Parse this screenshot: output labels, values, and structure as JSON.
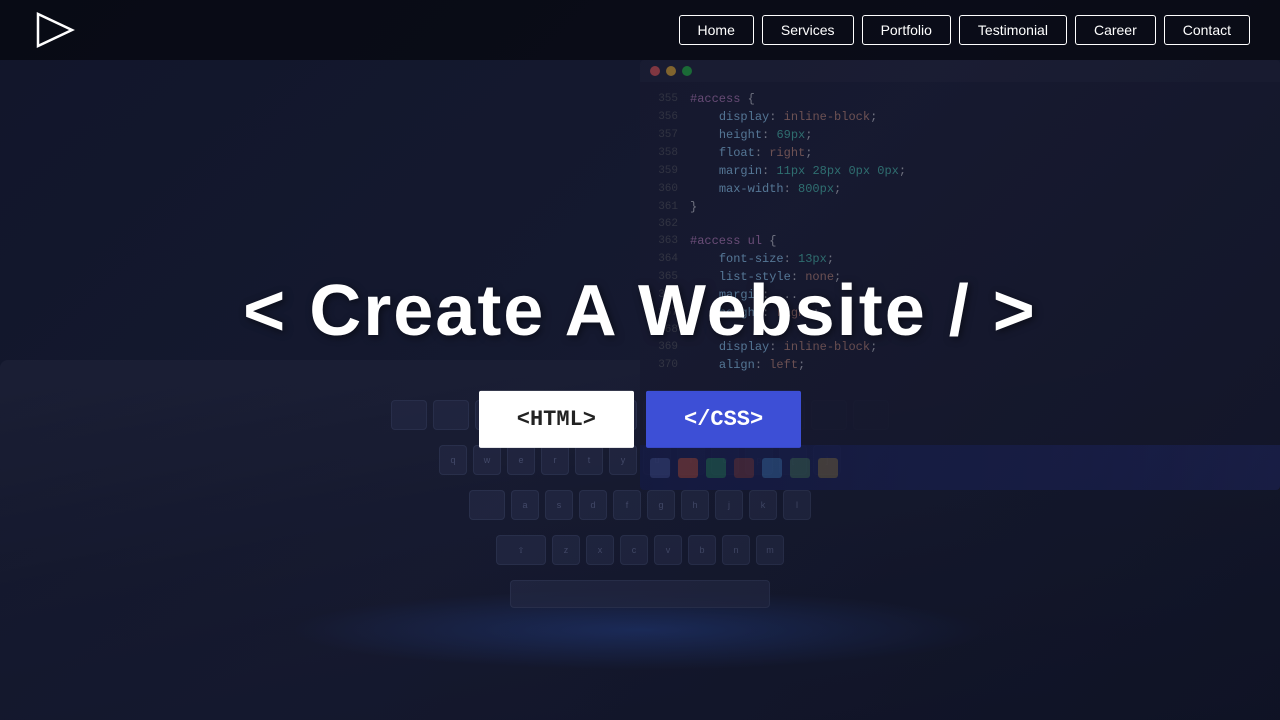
{
  "nav": {
    "links": [
      {
        "label": "Home",
        "id": "home"
      },
      {
        "label": "Services",
        "id": "services"
      },
      {
        "label": "Portfolio",
        "id": "portfolio"
      },
      {
        "label": "Testimonial",
        "id": "testimonial"
      },
      {
        "label": "Career",
        "id": "career"
      },
      {
        "label": "Contact",
        "id": "contact"
      }
    ]
  },
  "hero": {
    "title": "< Create A Website / >",
    "btn_html": "<HTML>",
    "btn_css": "</CSS>"
  },
  "code": {
    "lines": [
      {
        "num": "355",
        "content": "#access {"
      },
      {
        "num": "356",
        "content": "    display: inline-block;"
      },
      {
        "num": "357",
        "content": "    height: 69px;"
      },
      {
        "num": "358",
        "content": "    float: right;"
      },
      {
        "num": "359",
        "content": "    margin: 11px 28px 0px 0px;"
      },
      {
        "num": "360",
        "content": "    max-width: 800px;"
      },
      {
        "num": "361",
        "content": "}"
      },
      {
        "num": "362",
        "content": ""
      },
      {
        "num": "363",
        "content": "#access ul {"
      },
      {
        "num": "364",
        "content": "    font-size: 13px;"
      },
      {
        "num": "365",
        "content": "    list-style: none;"
      },
      {
        "num": "366",
        "content": "    margin: ..."
      },
      {
        "num": "367",
        "content": "    height: right;"
      },
      {
        "num": "368",
        "content": ""
      },
      {
        "num": "369",
        "content": "    display: inline-block;"
      },
      {
        "num": "370",
        "content": "    align: left;"
      }
    ]
  }
}
